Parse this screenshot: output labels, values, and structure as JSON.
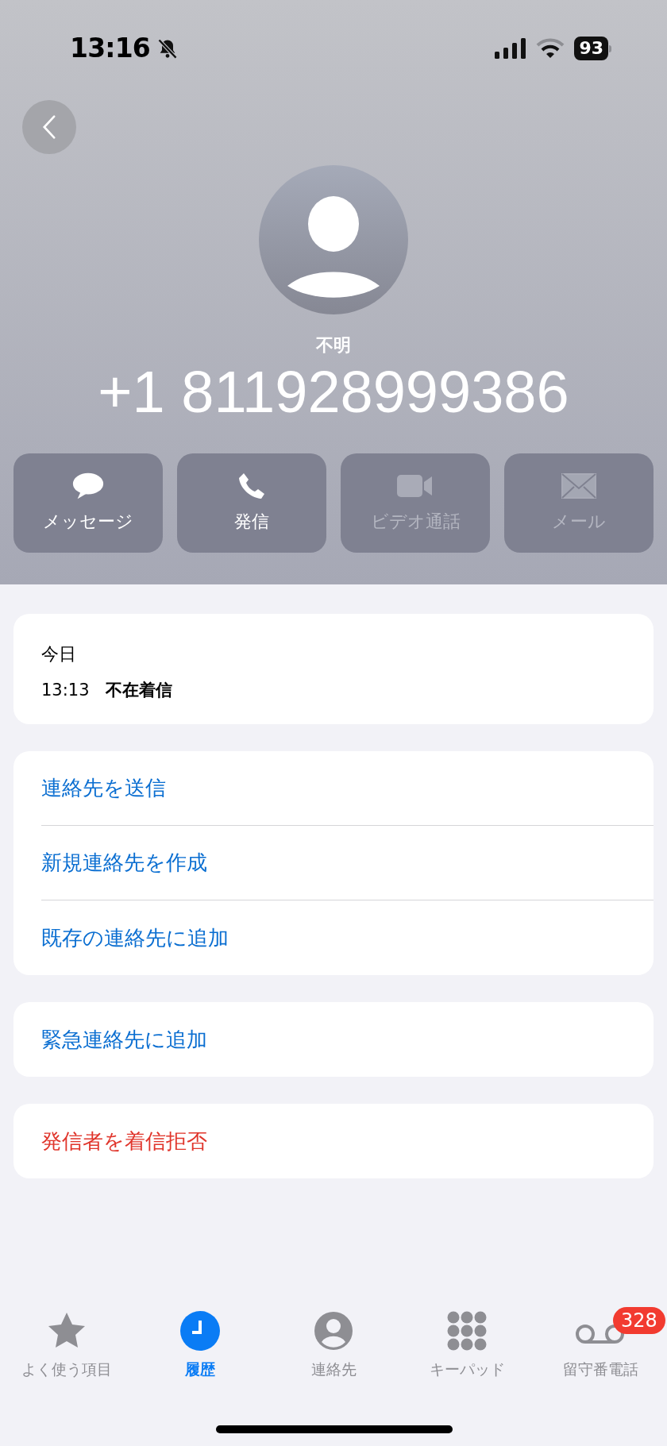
{
  "status_bar": {
    "time": "13:16",
    "silent": true,
    "battery": "93"
  },
  "contact": {
    "label": "不明",
    "number": "+1 811928999386"
  },
  "actions": [
    {
      "kind": "message",
      "label": "メッセージ",
      "disabled": false
    },
    {
      "kind": "call",
      "label": "発信",
      "disabled": false
    },
    {
      "kind": "video",
      "label": "ビデオ通話",
      "disabled": true
    },
    {
      "kind": "mail",
      "label": "メール",
      "disabled": true
    }
  ],
  "history": {
    "date": "今日",
    "entries": [
      {
        "time": "13:13",
        "type": "不在着信"
      }
    ]
  },
  "groups": [
    {
      "items": [
        {
          "label": "連絡先を送信",
          "destructive": false
        },
        {
          "label": "新規連絡先を作成",
          "destructive": false
        },
        {
          "label": "既存の連絡先に追加",
          "destructive": false
        }
      ]
    },
    {
      "items": [
        {
          "label": "緊急連絡先に追加",
          "destructive": false
        }
      ]
    },
    {
      "items": [
        {
          "label": "発信者を着信拒否",
          "destructive": true
        }
      ]
    }
  ],
  "tabs": [
    {
      "kind": "favorites",
      "label": "よく使う項目",
      "selected": false
    },
    {
      "kind": "recents",
      "label": "履歴",
      "selected": true
    },
    {
      "kind": "contacts",
      "label": "連絡先",
      "selected": false
    },
    {
      "kind": "keypad",
      "label": "キーパッド",
      "selected": false
    },
    {
      "kind": "voicemail",
      "label": "留守番電話",
      "selected": false,
      "badge": "328"
    }
  ]
}
